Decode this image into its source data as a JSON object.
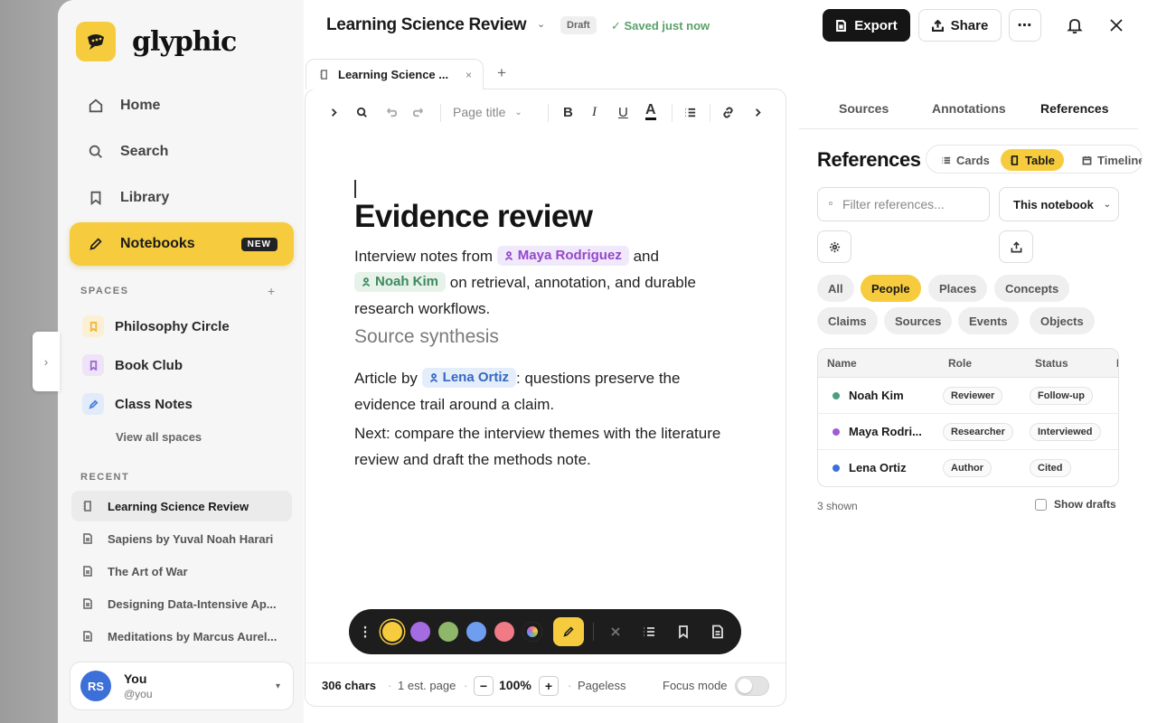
{
  "brand": {
    "name": "glyphic"
  },
  "colors": {
    "accent": "#f6cc3e",
    "dark": "#151515",
    "saved_green": "#5aa169",
    "avatar_blue": "#3d6fd9"
  },
  "nav": {
    "items": [
      {
        "label": "Home",
        "icon": "home-icon"
      },
      {
        "label": "Search",
        "icon": "search-icon"
      },
      {
        "label": "Library",
        "icon": "bookmark-icon"
      },
      {
        "label": "Notebooks",
        "icon": "pencil-icon",
        "badge": "NEW",
        "active": true
      }
    ]
  },
  "spaces": {
    "heading": "SPACES",
    "add_label": "+",
    "items": [
      {
        "label": "Philosophy Circle",
        "icon": "bookmark-icon",
        "color": "#f3b73a"
      },
      {
        "label": "Book Club",
        "icon": "bookmark-icon",
        "color": "#a169d6"
      },
      {
        "label": "Class Notes",
        "icon": "pencil-icon",
        "color": "#4e82dd"
      }
    ],
    "view_all": "View all spaces"
  },
  "recent": {
    "heading": "RECENT",
    "items": [
      {
        "label": "Learning Science Review",
        "active": true
      },
      {
        "label": "Sapiens by Yuval Noah Harari"
      },
      {
        "label": "The Art of War"
      },
      {
        "label": "Designing Data-Intensive Ap..."
      },
      {
        "label": "Meditations by Marcus Aurel..."
      }
    ]
  },
  "user": {
    "initials": "RS",
    "name": "You",
    "handle": "@you"
  },
  "header": {
    "title": "Learning Science Review",
    "status_pill": "Draft",
    "saved_text": "Saved just now",
    "export_label": "Export",
    "share_label": "Share",
    "more_label": "⋯"
  },
  "editor_tab": {
    "label": "Learning Science ...",
    "close": "×",
    "add": "+"
  },
  "toolbar": {
    "page_title_select": "Page title"
  },
  "document": {
    "heading": "Evidence review",
    "p1_before": "Interview notes from",
    "mention_maya": "Maya Rodriguez",
    "p1_and": "and",
    "mention_noah": "Noah Kim",
    "p1_after": "on retrieval, annotation, and durable research workflows.",
    "subheading": "Source synthesis",
    "p2_before": "Article by",
    "mention_lena": "Lena Ortiz",
    "p2_after": ": questions preserve the evidence trail around a claim.",
    "p3": "Next: compare the interview themes with the literature review and draft the methods note."
  },
  "highlighter": {
    "swatches": [
      "#f6cc3e",
      "#a56be0",
      "#8fb76a",
      "#6f9ef0",
      "#f07a85"
    ]
  },
  "status": {
    "chars": "306 chars",
    "pages": "1 est. page",
    "zoom_minus": "−",
    "zoom": "100%",
    "zoom_plus": "+",
    "layout": "Pageless",
    "focus_label": "Focus mode",
    "focus_on": false
  },
  "panel": {
    "tabs": [
      "Sources",
      "Annotations",
      "References"
    ],
    "active_tab": "References",
    "title": "References",
    "views": [
      "Cards",
      "Table",
      "Timeline"
    ],
    "active_view": "Table",
    "filter_placeholder": "Filter references...",
    "scope": "This notebook",
    "chips": [
      "All",
      "People",
      "Places",
      "Concepts",
      "Claims",
      "Sources",
      "Events",
      "Objects"
    ],
    "active_chip": "People",
    "columns": [
      "Name",
      "Role",
      "Status",
      "L"
    ],
    "rows": [
      {
        "name": "Noah Kim",
        "dot": "#4aa07d",
        "role": "Reviewer",
        "status": "Follow-up"
      },
      {
        "name": "Maya Rodri...",
        "dot": "#a15ad6",
        "role": "Researcher",
        "status": "Interviewed"
      },
      {
        "name": "Lena Ortiz",
        "dot": "#3d6fd9",
        "role": "Author",
        "status": "Cited"
      }
    ],
    "shown_count": "3 shown",
    "show_drafts": "Show drafts"
  }
}
